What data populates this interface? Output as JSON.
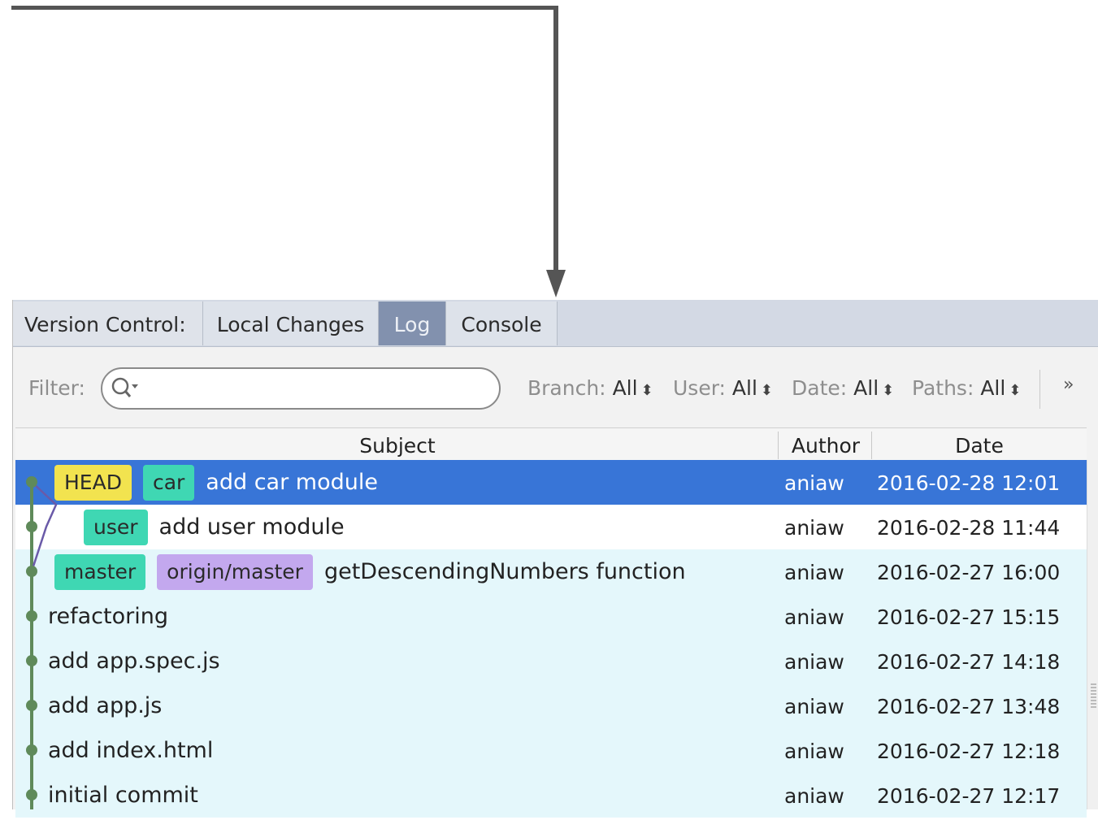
{
  "tabbar": {
    "title": "Version Control:",
    "tabs": [
      {
        "label": "Local Changes",
        "active": false
      },
      {
        "label": "Log",
        "active": true
      },
      {
        "label": "Console",
        "active": false
      }
    ]
  },
  "toolbar": {
    "filter_label": "Filter:",
    "search_value": "",
    "branch": {
      "label": "Branch:",
      "value": "All"
    },
    "user": {
      "label": "User:",
      "value": "All"
    },
    "date": {
      "label": "Date:",
      "value": "All"
    },
    "paths": {
      "label": "Paths:",
      "value": "All"
    },
    "more_label": "»"
  },
  "table": {
    "columns": {
      "subject": "Subject",
      "author": "Author",
      "date": "Date"
    },
    "rows": [
      {
        "badges": [
          "HEAD",
          "car"
        ],
        "subject": "add car module",
        "author": "aniaw",
        "date": "2016-02-28 12:01",
        "selected": true
      },
      {
        "badges": [
          "user"
        ],
        "subject": "add user module",
        "author": "aniaw",
        "date": "2016-02-28 11:44"
      },
      {
        "badges": [
          "master",
          "origin/master"
        ],
        "subject": "getDescendingNumbers function",
        "author": "aniaw",
        "date": "2016-02-27 16:00"
      },
      {
        "badges": [],
        "subject": "refactoring",
        "author": "aniaw",
        "date": "2016-02-27 15:15"
      },
      {
        "badges": [],
        "subject": "add app.spec.js",
        "author": "aniaw",
        "date": "2016-02-27 14:18"
      },
      {
        "badges": [],
        "subject": "add app.js",
        "author": "aniaw",
        "date": "2016-02-27 13:48"
      },
      {
        "badges": [],
        "subject": "add index.html",
        "author": "aniaw",
        "date": "2016-02-27 12:18"
      },
      {
        "badges": [],
        "subject": "initial commit",
        "author": "aniaw",
        "date": "2016-02-27 12:17"
      }
    ]
  },
  "colors": {
    "selection": "#3875d7",
    "graph_line": "#5f8a5a",
    "branch_line": "#6a5aa8",
    "head_badge": "#f2e34f",
    "branch_badge": "#3fd7b3",
    "remote_badge": "#c3a8ee"
  }
}
